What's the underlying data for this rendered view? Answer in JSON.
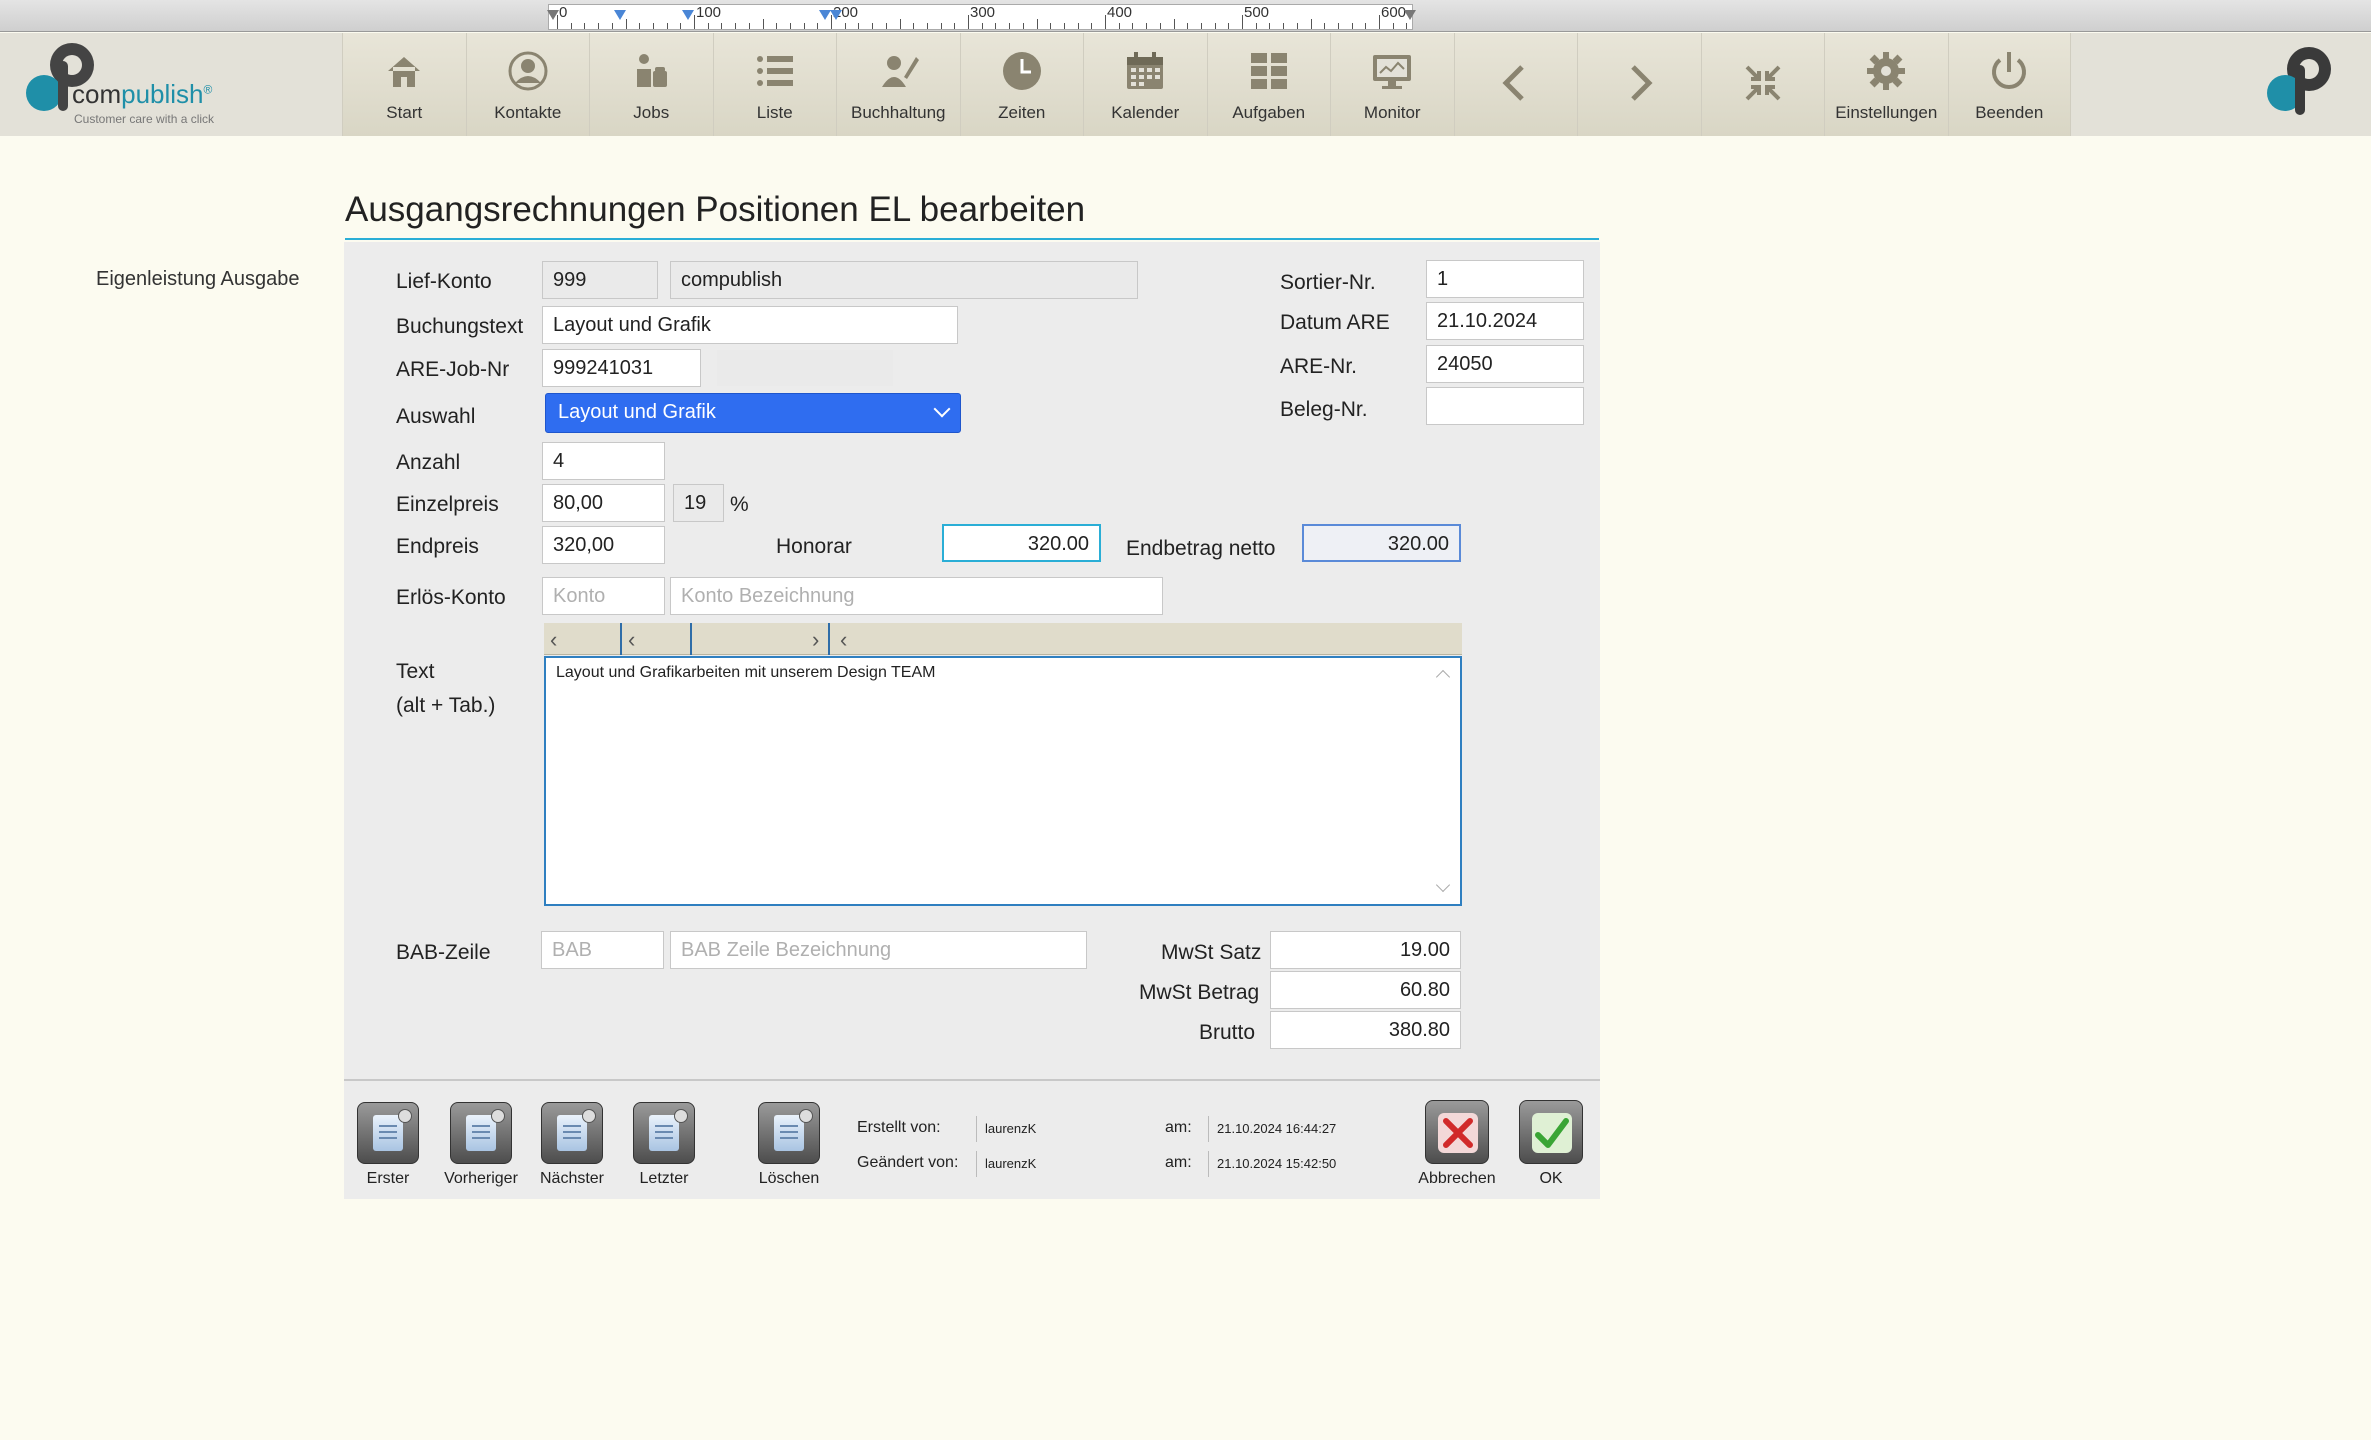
{
  "ruler": {
    "numbers": [
      "0",
      "100",
      "200",
      "300",
      "400",
      "500",
      "600"
    ]
  },
  "app": {
    "logo_text_a": "com",
    "logo_text_b": "publish",
    "logo_reg": "®",
    "tagline": "Customer care with a click"
  },
  "nav": [
    {
      "label": "Start",
      "icon": "home-icon"
    },
    {
      "label": "Kontakte",
      "icon": "contact-icon"
    },
    {
      "label": "Jobs",
      "icon": "jobs-icon"
    },
    {
      "label": "Liste",
      "icon": "list-icon"
    },
    {
      "label": "Buchhaltung",
      "icon": "accounting-icon"
    },
    {
      "label": "Zeiten",
      "icon": "clock-icon"
    },
    {
      "label": "Kalender",
      "icon": "calendar-icon"
    },
    {
      "label": "Aufgaben",
      "icon": "tasks-icon"
    },
    {
      "label": "Monitor",
      "icon": "monitor-icon"
    },
    {
      "label": "",
      "icon": "chevron-left-icon"
    },
    {
      "label": "",
      "icon": "chevron-right-icon"
    },
    {
      "label": "",
      "icon": "collapse-icon"
    },
    {
      "label": "Einstellungen",
      "icon": "gear-icon"
    },
    {
      "label": "Beenden",
      "icon": "power-icon"
    }
  ],
  "page": {
    "title": "Ausgangsrechnungen Positionen EL bearbeiten",
    "side_label": "Eigenleistung Ausgabe"
  },
  "form": {
    "lief_konto_label": "Lief-Konto",
    "lief_konto": "999",
    "lief_name": "compublish",
    "buchungstext_label": "Buchungstext",
    "buchungstext": "Layout und Grafik",
    "are_job_label": "ARE-Job-Nr",
    "are_job": "999241031",
    "are_job_extra": "",
    "auswahl_label": "Auswahl",
    "auswahl": "Layout und Grafik",
    "anzahl_label": "Anzahl",
    "anzahl": "4",
    "einzelpreis_label": "Einzelpreis",
    "einzelpreis": "80,00",
    "steuer": "19",
    "percent": "%",
    "endpreis_label": "Endpreis",
    "endpreis": "320,00",
    "honorar_label": "Honorar",
    "honorar": "320.00",
    "endbetrag_label": "Endbetrag netto",
    "endbetrag": "320.00",
    "erloes_label": "Erlös-Konto",
    "konto_placeholder": "Konto",
    "konto_bez_placeholder": "Konto Bezeichnung",
    "text_label": "Text",
    "text_hint": "(alt + Tab.)",
    "text": "Layout und Grafikarbeiten mit unserem Design TEAM",
    "bab_label": "BAB-Zeile",
    "bab_placeholder": "BAB",
    "bab_bez_placeholder": "BAB Zeile Bezeichnung",
    "sortier_label": "Sortier-Nr.",
    "sortier": "1",
    "datum_label": "Datum ARE",
    "datum": "21.10.2024",
    "are_nr_label": "ARE-Nr.",
    "are_nr": "24050",
    "beleg_label": "Beleg-Nr.",
    "beleg": "",
    "mwst_satz_label": "MwSt Satz",
    "mwst_satz": "19.00",
    "mwst_betrag_label": "MwSt Betrag",
    "mwst_betrag": "60.80",
    "brutto_label": "Brutto",
    "brutto": "380.80"
  },
  "footer": {
    "erster": "Erster",
    "vorheriger": "Vorheriger",
    "naechster": "Nächster",
    "letzter": "Letzter",
    "loeschen": "Löschen",
    "erstellt_label": "Erstellt von:",
    "erstellt_user": "laurenzK",
    "geaendert_label": "Geändert von:",
    "geaendert_user": "laurenzK",
    "am_label": "am:",
    "erstellt_am": "21.10.2024 16:44:27",
    "geaendert_am": "21.10.2024 15:42:50",
    "abbrechen": "Abbrechen",
    "ok": "OK"
  },
  "colors": {
    "accent": "#2aaed6",
    "select_bg": "#2f6df0",
    "toolbar_icon": "#8a8470",
    "page_bg": "#fcfbf0"
  }
}
